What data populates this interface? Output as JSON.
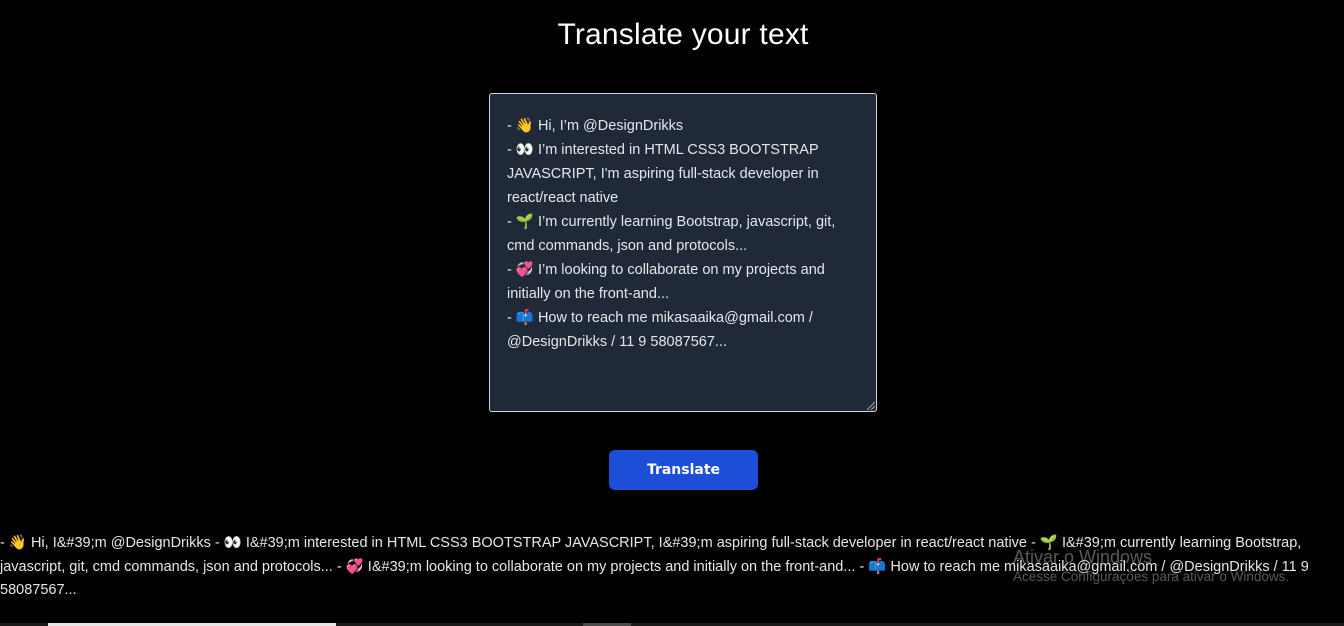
{
  "page": {
    "title": "Translate your text"
  },
  "input": {
    "value": "- 👋 Hi, I’m @DesignDrikks\n- 👀 I’m interested in HTML CSS3 BOOTSTRAP JAVASCRIPT, I'm aspiring full-stack developer in react/react native\n- 🌱 I’m currently learning Bootstrap, javascript, git, cmd commands, json and protocols...\n- 💞️ I’m looking to collaborate on my projects and initially on the front-and...\n- 📫 How to reach me mikasaaika@gmail.com / @DesignDrikks / 11 9 58087567..."
  },
  "actions": {
    "translate_label": "Translate"
  },
  "output": {
    "text": "- 👋 Hi, I&#39;m @DesignDrikks - 👀 I&#39;m interested in HTML CSS3 BOOTSTRAP JAVASCRIPT, I&#39;m aspiring full-stack developer in react/react native - 🌱 I&#39;m currently learning Bootstrap, javascript, git, cmd commands, json and protocols... - 💞️ I&#39;m looking to collaborate on my projects and initially on the front-and... - 📫 How to reach me mikasaaika@gmail.com / @DesignDrikks / 11 9 58087567..."
  },
  "watermark": {
    "title": "Ativar o Windows",
    "subtitle": "Acesse Configurações para ativar o Windows."
  },
  "colors": {
    "background": "#000000",
    "textarea_bg": "#1f2937",
    "button_bg": "#1d4ed8"
  }
}
